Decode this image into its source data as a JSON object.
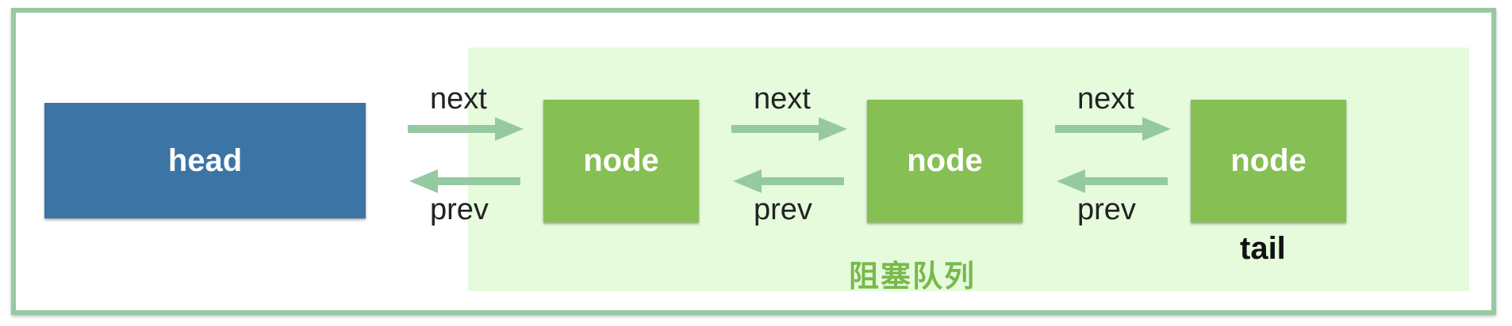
{
  "diagram": {
    "head_label": "head",
    "nodes": [
      {
        "label": "node"
      },
      {
        "label": "node"
      },
      {
        "label": "node"
      }
    ],
    "tail_label": "tail",
    "queue_label": "阻塞队列",
    "links": [
      {
        "next_label": "next",
        "prev_label": "prev"
      },
      {
        "next_label": "next",
        "prev_label": "prev"
      },
      {
        "next_label": "next",
        "prev_label": "prev"
      }
    ],
    "colors": {
      "frame_border": "#96c9a2",
      "queue_background": "#e5fbdc",
      "queue_label": "#79b84b",
      "head": "#3d74a6",
      "node": "#86bf54",
      "arrow": "#96c9a2"
    }
  }
}
